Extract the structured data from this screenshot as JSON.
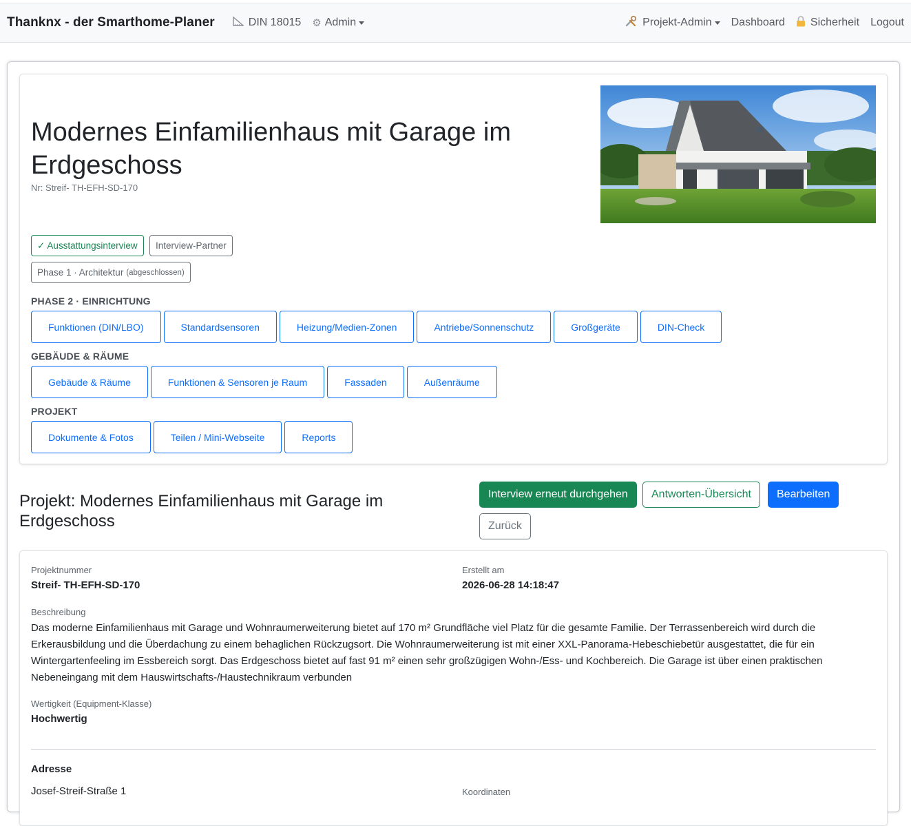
{
  "navbar": {
    "brand": "Thanknx - der Smarthome-Planer",
    "din": "DIN 18015",
    "admin": "Admin",
    "projekt_admin": "Projekt-Admin",
    "dashboard": "Dashboard",
    "sicherheit": "Sicherheit",
    "logout": "Logout"
  },
  "hero": {
    "title": "Modernes Einfamilienhaus mit Garage im Erdgeschoss",
    "nr": "Nr: Streif- TH-EFH-SD-170",
    "interview_badge": "✓ Ausstattungsinterview",
    "partner_badge": "Interview-Partner",
    "phase1_label": "Phase 1 · Architektur",
    "phase1_status": "(abgeschlossen)"
  },
  "sections": {
    "phase2": {
      "label": "PHASE 2 · EINRICHTUNG",
      "buttons": [
        "Funktionen (DIN/LBO)",
        "Standardsensoren",
        "Heizung/Medien-Zonen",
        "Antriebe/Sonnenschutz",
        "Großgeräte",
        "DIN-Check"
      ]
    },
    "gebaeude": {
      "label": "GEBÄUDE & RÄUME",
      "buttons": [
        "Gebäude & Räume",
        "Funktionen & Sensoren je Raum",
        "Fassaden",
        "Außenräume"
      ]
    },
    "projekt": {
      "label": "PROJEKT",
      "buttons": [
        "Dokumente & Fotos",
        "Teilen / Mini-Webseite",
        "Reports"
      ]
    }
  },
  "project": {
    "heading": "Projekt: Modernes Einfamilienhaus mit Garage im Erdgeschoss",
    "actions": {
      "interview": "Interview erneut durchgehen",
      "answers": "Antworten-Übersicht",
      "edit": "Bearbeiten",
      "back": "Zurück"
    }
  },
  "details": {
    "projektnummer_label": "Projektnummer",
    "projektnummer": "Streif- TH-EFH-SD-170",
    "erstellt_label": "Erstellt am",
    "erstellt": "2026-06-28 14:18:47",
    "beschreibung_label": "Beschreibung",
    "beschreibung": "Das moderne Einfamilienhaus mit Garage und Wohnraumerweiterung bietet auf 170 m² Grundfläche viel Platz für die gesamte Familie. Der Terrassenbereich wird durch die Erkerausbildung und die Überdachung zu einem behaglichen Rückzugsort. Die Wohnraumerweiterung ist mit einer XXL-Panorama-Hebeschiebetür ausgestattet, die für ein Wintergartenfeeling im Essbereich sorgt. Das Erdgeschoss bietet auf fast 91 m² einen sehr großzügigen Wohn-/Ess- und Kochbereich. Die Garage ist über einen praktischen Nebeneingang mit dem Hauswirtschafts-/Haustechnikraum verbunden",
    "wertigkeit_label": "Wertigkeit (Equipment-Klasse)",
    "wertigkeit": "Hochwertig",
    "adresse_label": "Adresse",
    "strasse": "Josef-Streif-Straße 1",
    "koordinaten_label": "Koordinaten"
  }
}
